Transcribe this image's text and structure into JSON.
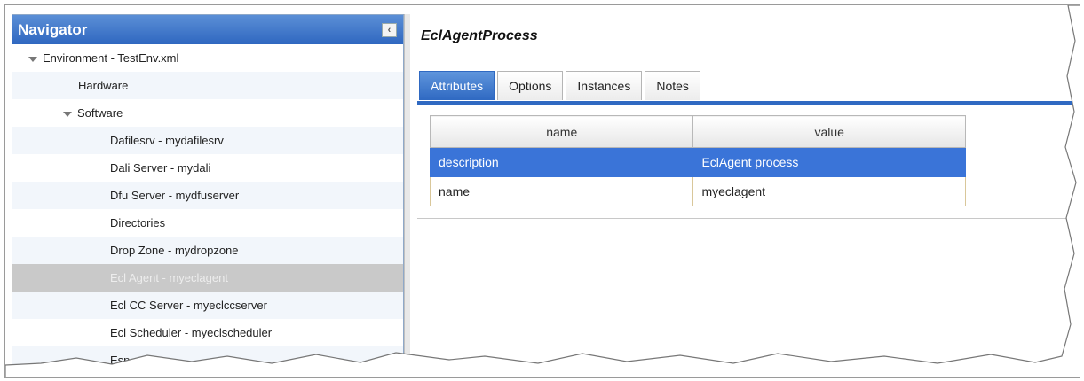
{
  "navigator": {
    "title": "Navigator",
    "collapse_glyph": "‹",
    "items": [
      {
        "label": "Environment - TestEnv.xml",
        "indent": 0,
        "expanded": true
      },
      {
        "label": "Hardware",
        "indent": 1,
        "expanded": false
      },
      {
        "label": "Software",
        "indent": 1,
        "expanded": true
      },
      {
        "label": "Dafilesrv - mydafilesrv",
        "indent": 2
      },
      {
        "label": "Dali Server - mydali",
        "indent": 2
      },
      {
        "label": "Dfu Server - mydfuserver",
        "indent": 2
      },
      {
        "label": "Directories",
        "indent": 2
      },
      {
        "label": "Drop Zone - mydropzone",
        "indent": 2
      },
      {
        "label": "Ecl Agent - myeclagent",
        "indent": 2,
        "selected": true
      },
      {
        "label": "Ecl CC Server - myeclccserver",
        "indent": 2
      },
      {
        "label": "Ecl Scheduler - myeclscheduler",
        "indent": 2
      },
      {
        "label": "Esp",
        "indent": 2
      }
    ]
  },
  "panel": {
    "title": "EclAgentProcess",
    "tabs": [
      "Attributes",
      "Options",
      "Instances",
      "Notes"
    ],
    "active_tab": "Attributes",
    "table": {
      "headers": [
        "name",
        "value"
      ],
      "rows": [
        {
          "name": "description",
          "value": "EclAgent process",
          "selected": true
        },
        {
          "name": "name",
          "value": "myeclagent",
          "selected": false
        }
      ]
    }
  },
  "colors": {
    "accent": "#2f69c2",
    "selection": "#3a74d8",
    "tree_selection": "#c9c9c9"
  }
}
